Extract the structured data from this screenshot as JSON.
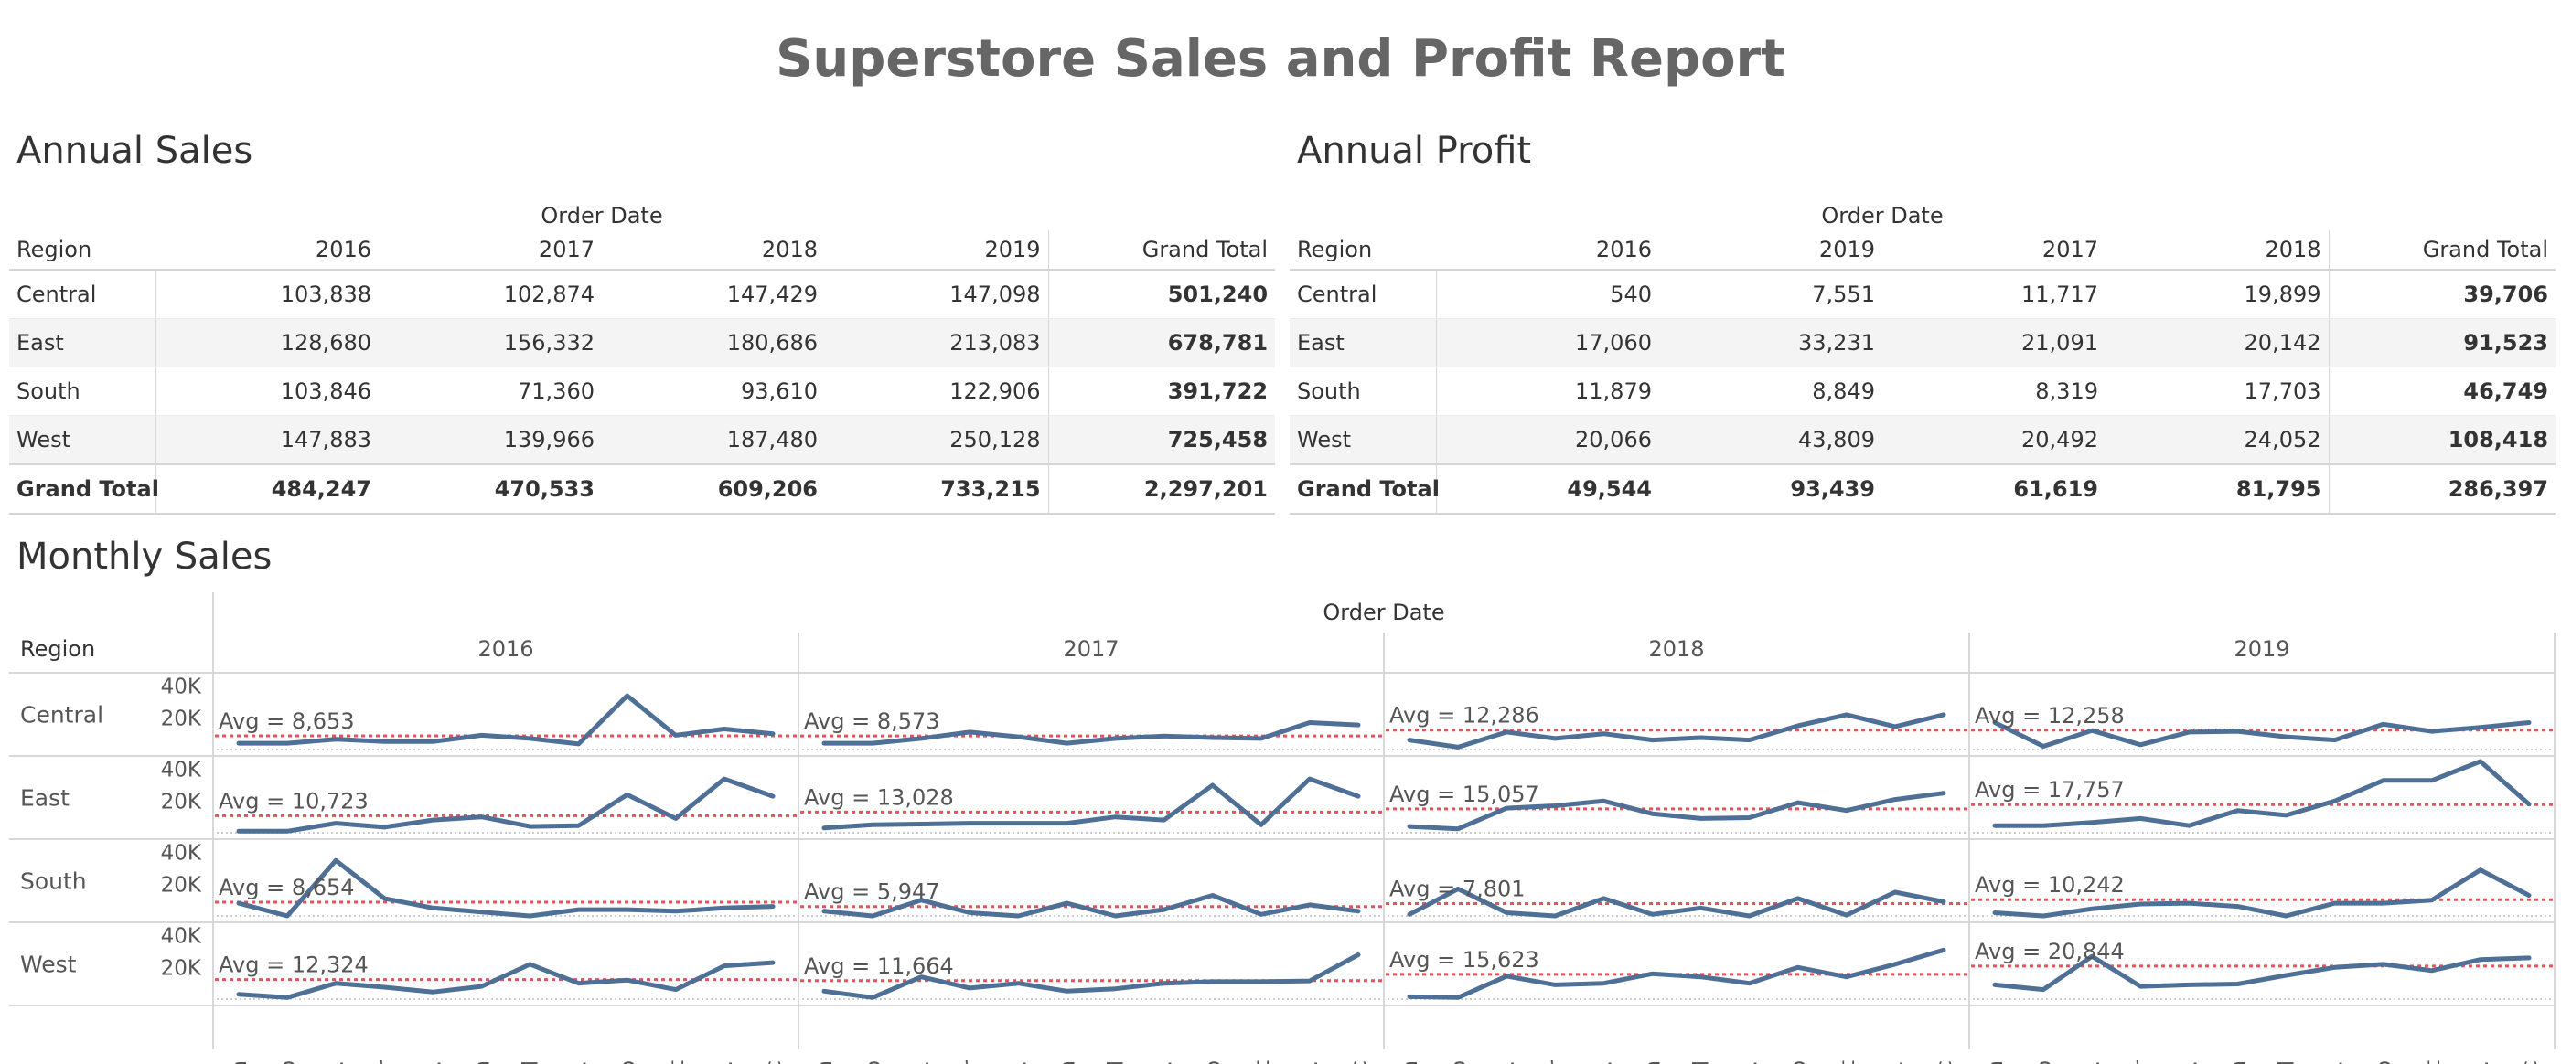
{
  "title": "Superstore Sales and Profit Report",
  "colors": {
    "line": "#4e6f96",
    "avg_line": "#e15759",
    "band": "#f4f4f4",
    "title_text": "#666666",
    "text": "#333333",
    "grid": "#d8d8d8"
  },
  "annual_sales": {
    "section_title": "Annual Sales",
    "order_date_label": "Order Date",
    "row_header": "Region",
    "columns": [
      "2016",
      "2017",
      "2018",
      "2019",
      "Grand Total"
    ],
    "rows": [
      {
        "region": "Central",
        "values": [
          "103,838",
          "102,874",
          "147,429",
          "147,098"
        ],
        "total": "501,240"
      },
      {
        "region": "East",
        "values": [
          "128,680",
          "156,332",
          "180,686",
          "213,083"
        ],
        "total": "678,781"
      },
      {
        "region": "South",
        "values": [
          "103,846",
          "71,360",
          "93,610",
          "122,906"
        ],
        "total": "391,722"
      },
      {
        "region": "West",
        "values": [
          "147,883",
          "139,966",
          "187,480",
          "250,128"
        ],
        "total": "725,458"
      }
    ],
    "grand_total": {
      "label": "Grand Total",
      "values": [
        "484,247",
        "470,533",
        "609,206",
        "733,215"
      ],
      "total": "2,297,201"
    }
  },
  "annual_profit": {
    "section_title": "Annual Profit",
    "order_date_label": "Order Date",
    "row_header": "Region",
    "columns": [
      "2016",
      "2019",
      "2017",
      "2018",
      "Grand Total"
    ],
    "rows": [
      {
        "region": "Central",
        "values": [
          "540",
          "7,551",
          "11,717",
          "19,899"
        ],
        "total": "39,706"
      },
      {
        "region": "East",
        "values": [
          "17,060",
          "33,231",
          "21,091",
          "20,142"
        ],
        "total": "91,523"
      },
      {
        "region": "South",
        "values": [
          "11,879",
          "8,849",
          "8,319",
          "17,703"
        ],
        "total": "46,749"
      },
      {
        "region": "West",
        "values": [
          "20,066",
          "43,809",
          "20,492",
          "24,052"
        ],
        "total": "108,418"
      }
    ],
    "grand_total": {
      "label": "Grand Total",
      "values": [
        "49,544",
        "93,439",
        "61,619",
        "81,795"
      ],
      "total": "286,397"
    }
  },
  "monthly_sales": {
    "section_title": "Monthly Sales",
    "order_date_label": "Order Date",
    "row_header": "Region",
    "years": [
      "2016",
      "2017",
      "2018",
      "2019"
    ],
    "month_labels": [
      "Jan",
      "Feb",
      "M..",
      "Apr",
      "M..",
      "Jun",
      "Jul",
      "A..",
      "Sep",
      "Oct",
      "N..",
      "Dec"
    ],
    "y_ticks": [
      "40K",
      "20K"
    ]
  },
  "chart_data": {
    "type": "line",
    "title": "Monthly Sales",
    "xlabel": "Order Date",
    "ylabel": "",
    "categories": [
      "Jan",
      "Feb",
      "M..",
      "Apr",
      "M..",
      "Jun",
      "Jul",
      "A..",
      "Sep",
      "Oct",
      "N..",
      "Dec"
    ],
    "ylim": [
      0,
      45000
    ],
    "y_ticks": [
      20000,
      40000
    ],
    "panels": [
      {
        "region": "Central",
        "year": "2016",
        "avg_label": "Avg = 8,653",
        "avg": 8653,
        "values": [
          4000,
          4000,
          6500,
          5000,
          5000,
          9000,
          7000,
          3500,
          34000,
          9000,
          13000,
          10000
        ]
      },
      {
        "region": "Central",
        "year": "2017",
        "avg_label": "Avg = 8,573",
        "avg": 8573,
        "values": [
          4000,
          4000,
          7000,
          11000,
          8000,
          4000,
          7000,
          8500,
          7500,
          7000,
          17000,
          15500
        ]
      },
      {
        "region": "Central",
        "year": "2018",
        "avg_label": "Avg = 12,286",
        "avg": 12286,
        "values": [
          6000,
          1500,
          11000,
          7000,
          10000,
          6000,
          7500,
          6000,
          15000,
          22000,
          14500,
          22000
        ]
      },
      {
        "region": "Central",
        "year": "2019",
        "avg_label": "Avg = 12,258",
        "avg": 12258,
        "values": [
          17000,
          2000,
          12000,
          3000,
          11000,
          11500,
          8000,
          6000,
          16000,
          11500,
          14000,
          17000
        ]
      },
      {
        "region": "East",
        "year": "2016",
        "avg_label": "Avg = 10,723",
        "avg": 10723,
        "values": [
          1000,
          1000,
          6000,
          3500,
          8000,
          10000,
          4000,
          4500,
          24000,
          9000,
          34000,
          23000
        ]
      },
      {
        "region": "East",
        "year": "2017",
        "avg_label": "Avg = 13,028",
        "avg": 13028,
        "values": [
          3000,
          5000,
          5500,
          6000,
          6000,
          6000,
          10000,
          8000,
          30000,
          5000,
          34000,
          23000
        ]
      },
      {
        "region": "East",
        "year": "2018",
        "avg_label": "Avg = 15,057",
        "avg": 15057,
        "values": [
          4000,
          2500,
          15500,
          17000,
          20000,
          12000,
          9000,
          9500,
          19000,
          14000,
          21000,
          25000
        ]
      },
      {
        "region": "East",
        "year": "2019",
        "avg_label": "Avg = 17,757",
        "avg": 17757,
        "values": [
          4500,
          4500,
          6500,
          9000,
          4500,
          14000,
          11000,
          20000,
          33000,
          33000,
          45000,
          18000
        ]
      },
      {
        "region": "South",
        "year": "2016",
        "avg_label": "Avg = 8,654",
        "avg": 8654,
        "values": [
          8000,
          0,
          35000,
          11000,
          5000,
          2500,
          0,
          4000,
          4000,
          3000,
          5000,
          6000
        ]
      },
      {
        "region": "South",
        "year": "2017",
        "avg_label": "Avg = 5,947",
        "avg": 5947,
        "values": [
          3000,
          0,
          10000,
          2000,
          0,
          8000,
          0,
          4000,
          13000,
          1000,
          7000,
          3000
        ]
      },
      {
        "region": "South",
        "year": "2018",
        "avg_label": "Avg = 7,801",
        "avg": 7801,
        "values": [
          1000,
          17000,
          2000,
          0,
          11000,
          1000,
          5000,
          0,
          11000,
          500,
          15000,
          9000
        ]
      },
      {
        "region": "South",
        "year": "2019",
        "avg_label": "Avg = 10,242",
        "avg": 10242,
        "values": [
          2000,
          0,
          4500,
          7500,
          8000,
          6000,
          0,
          8000,
          8000,
          10000,
          29000,
          13000
        ]
      },
      {
        "region": "West",
        "year": "2016",
        "avg_label": "Avg = 12,324",
        "avg": 12324,
        "values": [
          3000,
          1000,
          10000,
          7500,
          4500,
          8000,
          22000,
          10000,
          12000,
          6000,
          21000,
          23000
        ]
      },
      {
        "region": "West",
        "year": "2017",
        "avg_label": "Avg = 11,664",
        "avg": 11664,
        "values": [
          5000,
          1000,
          14000,
          7000,
          10000,
          5000,
          6500,
          10000,
          11000,
          11000,
          11500,
          28000
        ]
      },
      {
        "region": "West",
        "year": "2018",
        "avg_label": "Avg = 15,623",
        "avg": 15623,
        "values": [
          1500,
          1000,
          14500,
          9000,
          10000,
          16000,
          14000,
          10000,
          20000,
          14000,
          22000,
          31000
        ]
      },
      {
        "region": "West",
        "year": "2019",
        "avg_label": "Avg = 20,844",
        "avg": 20844,
        "values": [
          9000,
          6000,
          27000,
          8000,
          9000,
          9500,
          15000,
          20000,
          22000,
          18000,
          25000,
          26000
        ]
      }
    ]
  }
}
